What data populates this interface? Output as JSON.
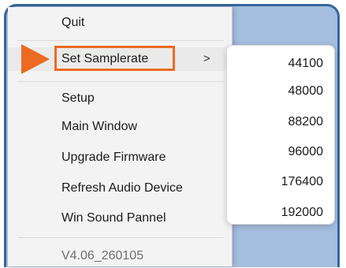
{
  "menu": {
    "items": [
      {
        "label": "Quit"
      },
      {
        "label": "Set Samplerate",
        "chevron": ">"
      },
      {
        "label": "Setup"
      },
      {
        "label": "Main Window"
      },
      {
        "label": "Upgrade Firmware"
      },
      {
        "label": "Refresh Audio Device"
      },
      {
        "label": "Win Sound Pannel"
      }
    ],
    "version": "V4.06_260105"
  },
  "submenu": {
    "items": [
      "44100",
      "48000",
      "88200",
      "96000",
      "176400",
      "192000"
    ]
  },
  "colors": {
    "frame_border": "#37669a",
    "desktop_bg": "#a5bedf",
    "callout": "#ed6a22",
    "menu_bg": "#f3f3f3"
  }
}
